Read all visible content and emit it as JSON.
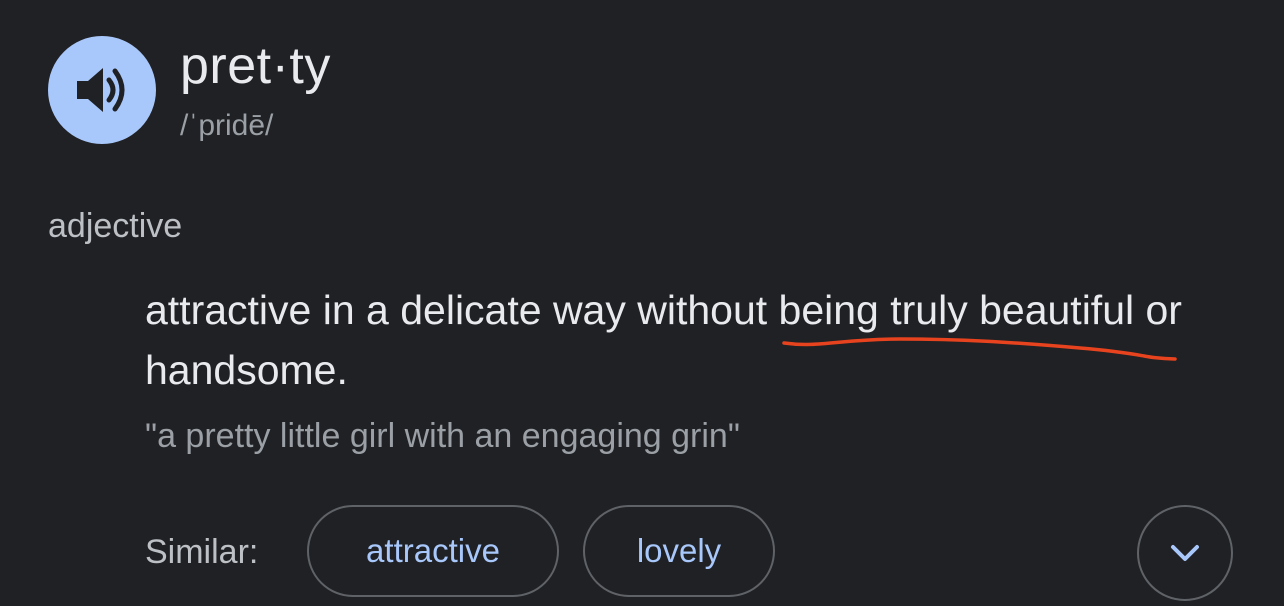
{
  "entry": {
    "headword": "pret·ty",
    "phonetic": "/ˈpridē/",
    "part_of_speech": "adjective",
    "definition": "attractive in a delicate way without being truly beautiful or handsome.",
    "example": "\"a pretty little girl with an engaging grin\""
  },
  "similar": {
    "label": "Similar:",
    "chips": [
      "attractive",
      "lovely"
    ]
  },
  "icons": {
    "audio": "speaker-icon",
    "expand": "chevron-down-icon"
  },
  "colors": {
    "background": "#202124",
    "accent": "#a8c7fa",
    "annotation": "#e8431f"
  }
}
